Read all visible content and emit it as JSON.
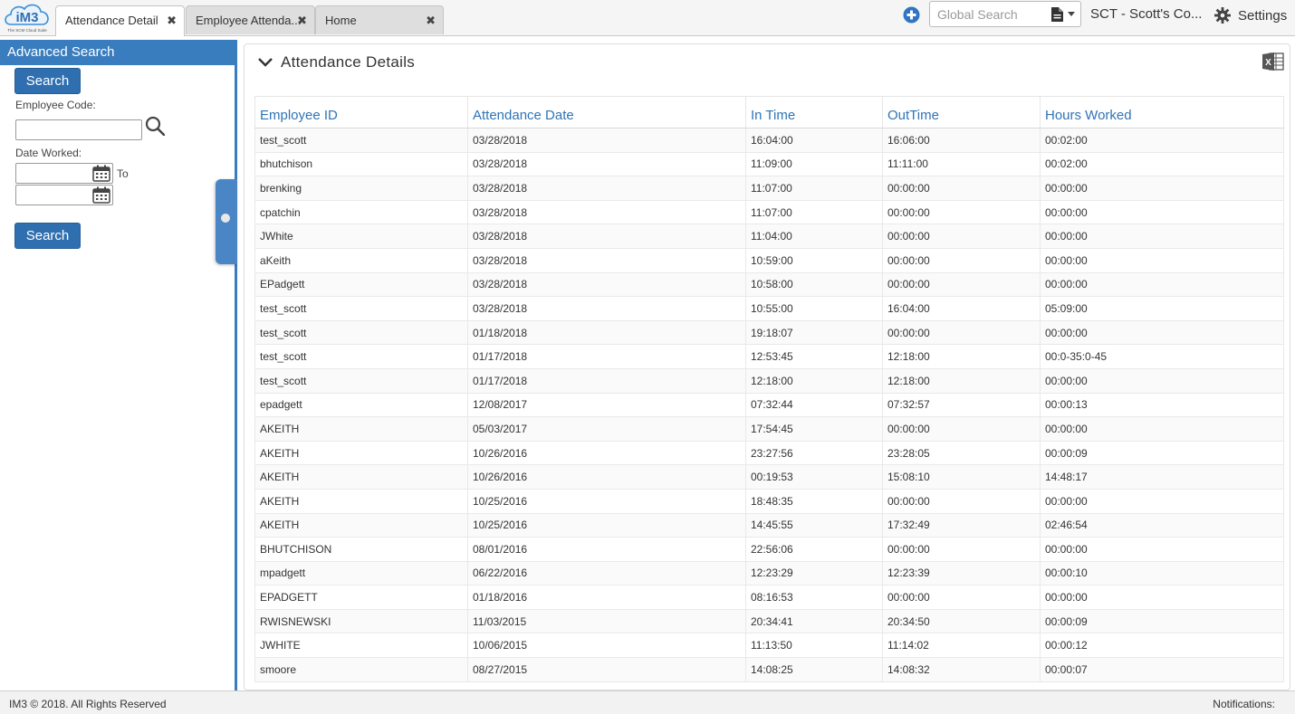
{
  "app": {
    "logo_text": "iM3",
    "logo_tagline": "The SCM Cloud Suite"
  },
  "tabs": [
    {
      "label": "Attendance Detail",
      "active": true
    },
    {
      "label": "Employee Attenda...",
      "active": false
    },
    {
      "label": "Home",
      "active": false
    }
  ],
  "header": {
    "global_search_placeholder": "Global Search",
    "company": "SCT - Scott's Co...",
    "settings_label": "Settings"
  },
  "sidebar": {
    "title": "Advanced Search",
    "search_label": "Search",
    "employee_code_label": "Employee Code:",
    "employee_code_value": "",
    "date_worked_label": "Date Worked:",
    "date_from_value": "",
    "to_label": "To",
    "date_to_value": ""
  },
  "main": {
    "title": "Attendance Details",
    "columns": [
      "Employee ID",
      "Attendance Date",
      "In Time",
      "OutTime",
      "Hours Worked"
    ],
    "rows": [
      [
        "test_scott",
        "03/28/2018",
        "16:04:00",
        "16:06:00",
        "00:02:00"
      ],
      [
        "bhutchison",
        "03/28/2018",
        "11:09:00",
        "11:11:00",
        "00:02:00"
      ],
      [
        "brenking",
        "03/28/2018",
        "11:07:00",
        "00:00:00",
        "00:00:00"
      ],
      [
        "cpatchin",
        "03/28/2018",
        "11:07:00",
        "00:00:00",
        "00:00:00"
      ],
      [
        "JWhite",
        "03/28/2018",
        "11:04:00",
        "00:00:00",
        "00:00:00"
      ],
      [
        "aKeith",
        "03/28/2018",
        "10:59:00",
        "00:00:00",
        "00:00:00"
      ],
      [
        "EPadgett",
        "03/28/2018",
        "10:58:00",
        "00:00:00",
        "00:00:00"
      ],
      [
        "test_scott",
        "03/28/2018",
        "10:55:00",
        "16:04:00",
        "05:09:00"
      ],
      [
        "test_scott",
        "01/18/2018",
        "19:18:07",
        "00:00:00",
        "00:00:00"
      ],
      [
        "test_scott",
        "01/17/2018",
        "12:53:45",
        "12:18:00",
        "00:0-35:0-45"
      ],
      [
        "test_scott",
        "01/17/2018",
        "12:18:00",
        "12:18:00",
        "00:00:00"
      ],
      [
        "epadgett",
        "12/08/2017",
        "07:32:44",
        "07:32:57",
        "00:00:13"
      ],
      [
        "AKEITH",
        "05/03/2017",
        "17:54:45",
        "00:00:00",
        "00:00:00"
      ],
      [
        "AKEITH",
        "10/26/2016",
        "23:27:56",
        "23:28:05",
        "00:00:09"
      ],
      [
        "AKEITH",
        "10/26/2016",
        "00:19:53",
        "15:08:10",
        "14:48:17"
      ],
      [
        "AKEITH",
        "10/25/2016",
        "18:48:35",
        "00:00:00",
        "00:00:00"
      ],
      [
        "AKEITH",
        "10/25/2016",
        "14:45:55",
        "17:32:49",
        "02:46:54"
      ],
      [
        "BHUTCHISON",
        "08/01/2016",
        "22:56:06",
        "00:00:00",
        "00:00:00"
      ],
      [
        "mpadgett",
        "06/22/2016",
        "12:23:29",
        "12:23:39",
        "00:00:10"
      ],
      [
        "EPADGETT",
        "01/18/2016",
        "08:16:53",
        "00:00:00",
        "00:00:00"
      ],
      [
        "RWISNEWSKI",
        "11/03/2015",
        "20:34:41",
        "20:34:50",
        "00:00:09"
      ],
      [
        "JWHITE",
        "10/06/2015",
        "11:13:50",
        "11:14:02",
        "00:00:12"
      ],
      [
        "smoore",
        "08/27/2015",
        "14:08:25",
        "14:08:32",
        "00:00:07"
      ]
    ]
  },
  "footer": {
    "copyright": "IM3 © 2018. All Rights Reserved",
    "notifications_label": "Notifications:"
  },
  "colors": {
    "accent": "#3a7dbf",
    "button": "#2f6fb0",
    "header_text": "#2f74b5",
    "excel_green": "#1f6e43"
  }
}
